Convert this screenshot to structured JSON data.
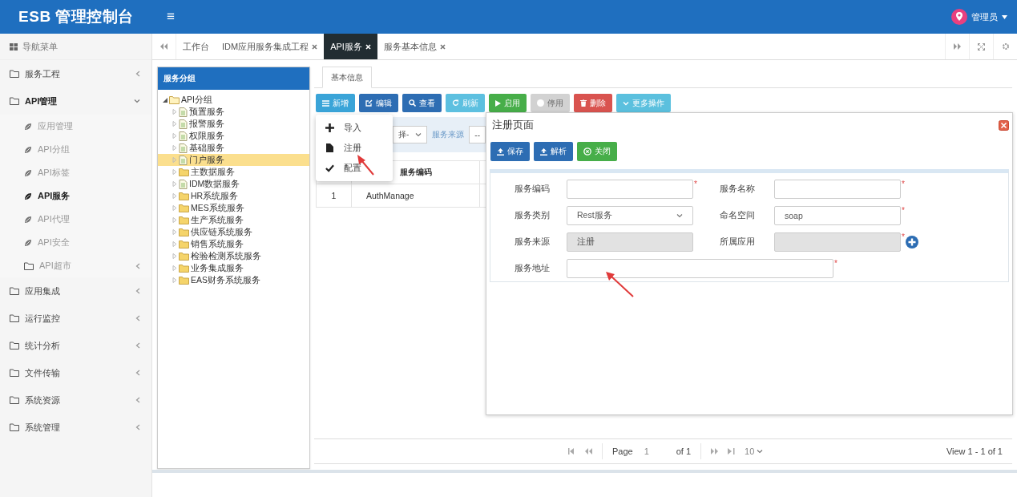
{
  "header": {
    "title": "ESB 管理控制台",
    "menu_glyph": "≡",
    "user": "管理员"
  },
  "sidebar": {
    "title": "导航菜单",
    "items": [
      {
        "label": "服务工程",
        "expanded": false
      },
      {
        "label": "API管理",
        "expanded": true,
        "children": [
          {
            "label": "应用管理",
            "kind": "leaf",
            "selected": false
          },
          {
            "label": "API分组",
            "kind": "leaf",
            "selected": false
          },
          {
            "label": "API标签",
            "kind": "leaf",
            "selected": false
          },
          {
            "label": "API服务",
            "kind": "leaf",
            "selected": true
          },
          {
            "label": "API代理",
            "kind": "leaf",
            "selected": false
          },
          {
            "label": "API安全",
            "kind": "leaf",
            "selected": false
          },
          {
            "label": "API超市",
            "kind": "group",
            "selected": false
          }
        ]
      },
      {
        "label": "应用集成",
        "expanded": false
      },
      {
        "label": "运行监控",
        "expanded": false
      },
      {
        "label": "统计分析",
        "expanded": false
      },
      {
        "label": "文件传输",
        "expanded": false
      },
      {
        "label": "系统资源",
        "expanded": false
      },
      {
        "label": "系统管理",
        "expanded": false
      }
    ]
  },
  "tabs": [
    {
      "label": "工作台",
      "closable": false,
      "selected": false
    },
    {
      "label": "IDM应用服务集成工程",
      "closable": true,
      "selected": false
    },
    {
      "label": "API服务",
      "closable": true,
      "selected": true
    },
    {
      "label": "服务基本信息",
      "closable": true,
      "selected": false
    }
  ],
  "tree": {
    "title": "服务分组",
    "root": {
      "label": "API分组",
      "expanded": true,
      "children": [
        {
          "label": "预置服务",
          "kind": "file",
          "selected": false
        },
        {
          "label": "报警服务",
          "kind": "file",
          "selected": false
        },
        {
          "label": "权限服务",
          "kind": "file",
          "selected": false
        },
        {
          "label": "基础服务",
          "kind": "file",
          "selected": false
        },
        {
          "label": "门户服务",
          "kind": "file",
          "selected": true
        },
        {
          "label": "主数据服务",
          "kind": "folder",
          "selected": false
        },
        {
          "label": "IDM数据服务",
          "kind": "file",
          "selected": false
        },
        {
          "label": "HR系统服务",
          "kind": "folder",
          "selected": false
        },
        {
          "label": "MES系统服务",
          "kind": "folder",
          "selected": false
        },
        {
          "label": "生产系统服务",
          "kind": "folder",
          "selected": false
        },
        {
          "label": "供应链系统服务",
          "kind": "folder",
          "selected": false
        },
        {
          "label": "销售系统服务",
          "kind": "folder",
          "selected": false
        },
        {
          "label": "检验检测系统服务",
          "kind": "folder",
          "selected": false
        },
        {
          "label": "业务集成服务",
          "kind": "folder",
          "selected": false
        },
        {
          "label": "EAS财务系统服务",
          "kind": "folder",
          "selected": false
        }
      ]
    }
  },
  "main": {
    "tabs": [
      {
        "label": "基本信息",
        "selected": true
      }
    ],
    "toolbar": [
      {
        "label": "新增",
        "kind": "add",
        "disabled": false
      },
      {
        "label": "编辑",
        "kind": "edit",
        "disabled": false
      },
      {
        "label": "查看",
        "kind": "view",
        "disabled": false
      },
      {
        "label": "刷新",
        "kind": "refresh",
        "disabled": false
      },
      {
        "label": "启用",
        "kind": "enable",
        "disabled": false
      },
      {
        "label": "停用",
        "kind": "disable",
        "disabled": true
      },
      {
        "label": "删除",
        "kind": "delete",
        "disabled": false
      },
      {
        "label": "更多操作",
        "kind": "more",
        "disabled": false
      }
    ],
    "filter": {
      "select_value": "择-",
      "label": "服务来源",
      "select2_value": "--"
    },
    "table": {
      "columns": [
        "服务编码"
      ],
      "rows": [
        {
          "index": "1",
          "cells": [
            "AuthManage"
          ]
        }
      ]
    },
    "pager": {
      "page_label": "Page",
      "page": "1",
      "of": "of 1",
      "page_size": "10",
      "summary": "View 1 - 1 of 1"
    }
  },
  "menu": {
    "items": [
      {
        "label": "导入",
        "kind": "import"
      },
      {
        "label": "注册",
        "kind": "register"
      },
      {
        "label": "配置",
        "kind": "config"
      }
    ]
  },
  "dialog": {
    "title": "注册页面",
    "buttons": [
      {
        "label": "保存",
        "kind": "save"
      },
      {
        "label": "解析",
        "kind": "parse"
      },
      {
        "label": "关闭",
        "kind": "close"
      }
    ],
    "fields": [
      {
        "label": "服务编码",
        "kind": "text",
        "required_mark": "*",
        "disabled": false
      },
      {
        "label": "服务名称",
        "kind": "text",
        "required_mark": "*",
        "disabled": false
      },
      {
        "label": "服务类别",
        "kind": "select",
        "value": "Rest服务",
        "disabled": false
      },
      {
        "label": "命名空间",
        "kind": "text",
        "value": "soap",
        "required_mark": "*",
        "disabled": false
      },
      {
        "label": "服务来源",
        "kind": "text",
        "value": "注册",
        "disabled": true
      },
      {
        "label": "所属应用",
        "kind": "text",
        "required_mark": "*",
        "disabled": true,
        "addable": true
      },
      {
        "label": "服务地址",
        "kind": "wide",
        "required_mark": "*",
        "disabled": false
      }
    ]
  }
}
